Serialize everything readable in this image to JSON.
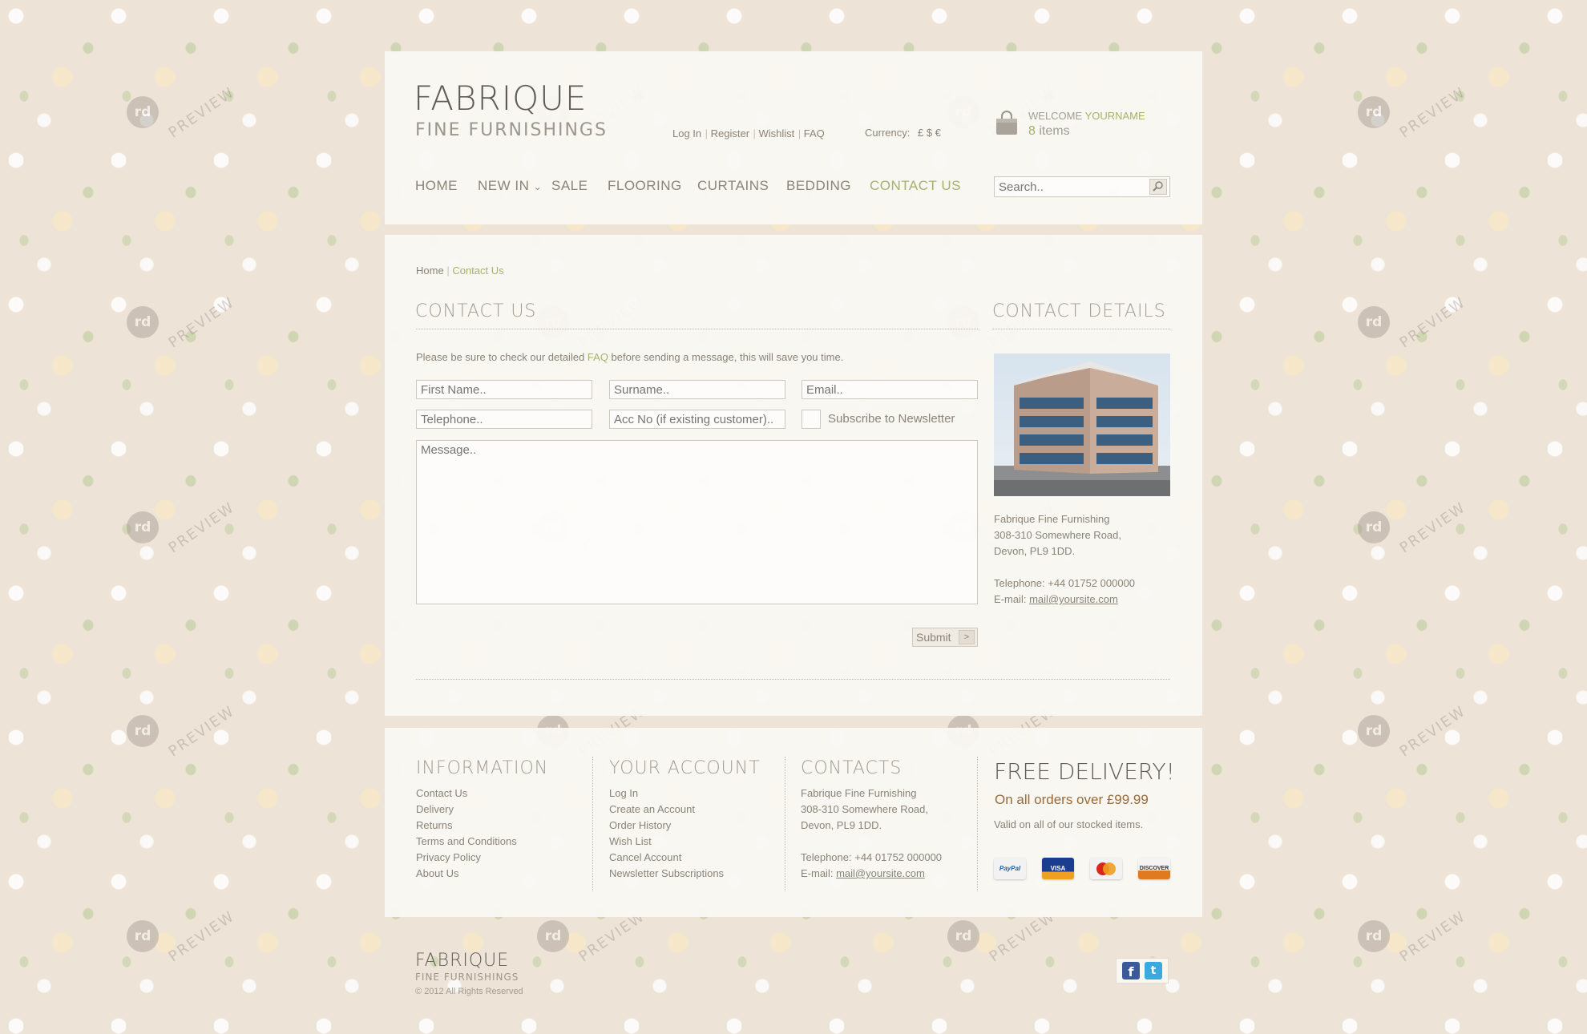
{
  "logo": {
    "title": "FABRIQUE",
    "subtitle": "FINE FURNISHINGS"
  },
  "top_links": [
    "Log In",
    "Register",
    "Wishlist",
    "FAQ"
  ],
  "currency": {
    "label": "Currency:",
    "symbols": "£ $ €"
  },
  "cart": {
    "welcome": "WELCOME",
    "username": "YOURNAME",
    "count": "8",
    "items_label": "items"
  },
  "nav": {
    "items": [
      "HOME",
      "NEW IN",
      "SALE",
      "FLOORING",
      "CURTAINS",
      "BEDDING",
      "CONTACT US"
    ],
    "dropdown_marker": "⌄",
    "active": "CONTACT US"
  },
  "search": {
    "placeholder": "Search.."
  },
  "breadcrumb": {
    "home": "Home",
    "separator": "|",
    "current": "Contact Us"
  },
  "contact": {
    "title": "CONTACT US",
    "intro_before": "Please be sure to check our detailed ",
    "intro_link": "FAQ",
    "intro_after": " before sending a message, this will save you time.",
    "fields": {
      "first_name": "First Name..",
      "surname": "Surname..",
      "email": "Email..",
      "telephone": "Telephone..",
      "acc_no": "Acc No (if existing customer)..",
      "message": "Message.."
    },
    "subscribe_label": "Subscribe to Newsletter",
    "submit_label": "Submit"
  },
  "details": {
    "title": "CONTACT DETAILS",
    "address": [
      "Fabrique Fine Furnishing",
      "308-310 Somewhere Road,",
      "Devon,  PL9 1DD."
    ],
    "telephone": "Telephone: +44 01752 000000",
    "email_label": "E-mail:",
    "email": "mail@yoursite.com"
  },
  "footer": {
    "information": {
      "title": "INFORMATION",
      "links": [
        "Contact Us",
        "Delivery",
        "Returns",
        "Terms and Conditions",
        "Privacy Policy",
        "About Us"
      ]
    },
    "account": {
      "title": "YOUR ACCOUNT",
      "links": [
        "Log In",
        "Create an Account",
        "Order History",
        "Wish List",
        "Cancel Account",
        "Newsletter Subscriptions"
      ]
    },
    "contacts": {
      "title": "CONTACTS",
      "address": [
        "Fabrique Fine Furnishing",
        "308-310 Somewhere Road,",
        "Devon,  PL9 1DD."
      ],
      "telephone": "Telephone: +44 01752 000000",
      "email_label": "E-mail:",
      "email": "mail@yoursite.com"
    },
    "delivery": {
      "title": "FREE DELIVERY!",
      "offer": "On all orders over £99.99",
      "note": "Valid on all of our stocked items."
    },
    "payment_cards": [
      "PayPal",
      "VISA",
      "MasterCard",
      "DISCOVER"
    ],
    "card_colors": [
      "#1f5fa3",
      "#1a3d8f",
      "#e8871e",
      "#e07a20"
    ]
  },
  "bottom": {
    "title": "FABRIQUE",
    "subtitle": "FINE FURNISHINGS",
    "copyright": "© 2012 All Rights Reserved"
  },
  "watermark": {
    "logo": "rd",
    "text": "PREVIEW"
  },
  "colors": {
    "accent": "#a4b36a",
    "text": "#8a8378",
    "brown": "#9a6a3a"
  }
}
